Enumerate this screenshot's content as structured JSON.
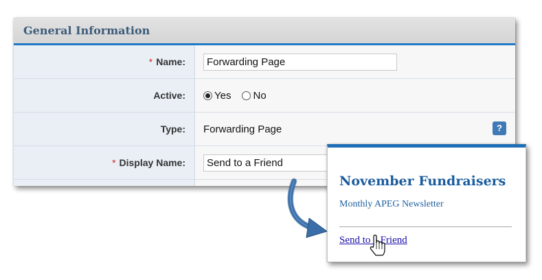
{
  "panel": {
    "title": "General Information"
  },
  "form": {
    "required_marker": "*",
    "name": {
      "label": "Name:",
      "value": "Forwarding Page"
    },
    "active": {
      "label": "Active:",
      "options": [
        {
          "label": "Yes",
          "checked": true
        },
        {
          "label": "No",
          "checked": false
        }
      ]
    },
    "type": {
      "label": "Type:",
      "value": "Forwarding Page",
      "help_icon": "question-mark-icon",
      "help_text": "?"
    },
    "display_name": {
      "label": "Display Name:",
      "value": "Send to a Friend"
    }
  },
  "preview": {
    "title": "November Fundraisers",
    "subtitle": "Monthly APEG Newsletter",
    "link": "Send to a Friend"
  },
  "colors": {
    "accent_blue": "#1f78c6",
    "label_background": "#e9eff5",
    "header_text": "#3d5c7a",
    "required_red": "#d22828",
    "link": "#1a0dab",
    "arrow": "#3a6ea8"
  },
  "icons": [
    "question-mark-icon",
    "curved-arrow-icon",
    "hand-pointer-icon"
  ]
}
